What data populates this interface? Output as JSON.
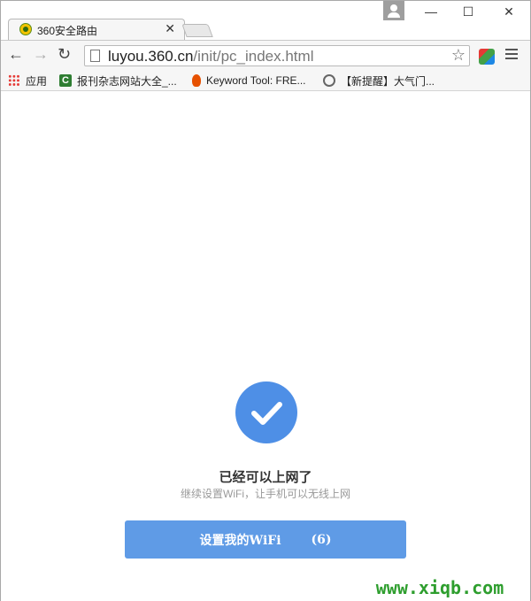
{
  "browser": {
    "tab": {
      "title": "360安全路由",
      "close": "✕"
    },
    "window_controls": {
      "minimize": "—",
      "maximize": "☐",
      "close": "✕"
    },
    "toolbar": {
      "back": "←",
      "forward": "→",
      "reload": "↻",
      "url_host": "luyou.360.cn",
      "url_path": "/init/pc_index.html",
      "star": "☆"
    },
    "bookmarks": [
      {
        "label": "应用"
      },
      {
        "label": "报刊杂志网站大全_...",
        "icon_letter": "C"
      },
      {
        "label": "Keyword Tool: FRE..."
      },
      {
        "label": "【新提醒】大气门..."
      }
    ]
  },
  "page": {
    "heading": "已经可以上网了",
    "subtext": "继续设置WiFi，让手机可以无线上网",
    "cta_label": "设置我的WiFi",
    "cta_count": "(6)"
  },
  "watermark": "www.xiqb.com",
  "colors": {
    "accent": "#4e8fe6",
    "button": "#5f9be6",
    "watermark": "#2e9e2e"
  }
}
